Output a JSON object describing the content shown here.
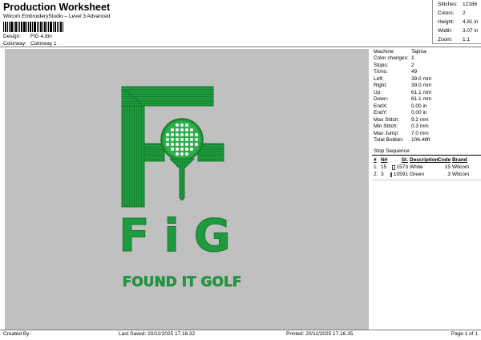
{
  "header": {
    "title": "Production Worksheet",
    "subtitle": "Wilcom EmbroideryStudio – Level 3 Advanced",
    "design_label": "Design:",
    "design_value": "FIG 4.8in",
    "colorway_label": "Colorway:",
    "colorway_value": "Colorway 1"
  },
  "stats": {
    "stitches_label": "Stitches:",
    "stitches": "12166",
    "colors_label": "Colors:",
    "colors": "2",
    "height_label": "Height:",
    "height": "4.81 in",
    "width_label": "Width:",
    "width": "3.07 in",
    "zoom_label": "Zoom:",
    "zoom": "1:1"
  },
  "specs": [
    {
      "label": "Machine:",
      "value": "Tajima"
    },
    {
      "label": "Color changes:",
      "value": "1"
    },
    {
      "label": "Stops:",
      "value": "2"
    },
    {
      "label": "Trims:",
      "value": "49"
    },
    {
      "label": "Left:",
      "value": "39.0 mm"
    },
    {
      "label": "Right:",
      "value": "39.0 mm"
    },
    {
      "label": "Up:",
      "value": "61.1 mm"
    },
    {
      "label": "Down:",
      "value": "61.1 mm"
    },
    {
      "label": "EndX:",
      "value": "0.00 in"
    },
    {
      "label": "EndY:",
      "value": "0.00 in"
    },
    {
      "label": "Max Stitch:",
      "value": "9.2 mm"
    },
    {
      "label": "Min Stitch:",
      "value": "0.3 mm"
    },
    {
      "label": "Max Jump:",
      "value": "7.0 mm"
    },
    {
      "label": "Total Bobbin:",
      "value": "106.48ft"
    }
  ],
  "sequence": {
    "title": "Stop Sequence:",
    "headers": {
      "num": "#",
      "n": "N#",
      "st": "St.",
      "desc": "Description",
      "code": "Code",
      "brand": "Brand"
    },
    "rows": [
      {
        "num": "1.",
        "n": "15",
        "st": "1573",
        "desc": "White",
        "code": "15",
        "brand": "Wilcom",
        "color": "#ffffff"
      },
      {
        "num": "2.",
        "n": "3",
        "st": "10591",
        "desc": "Green",
        "code": "3",
        "brand": "Wilcom",
        "color": "#1a9a3c"
      }
    ]
  },
  "design": {
    "text_main": "FiG",
    "text_tagline": "FOUND IT GOLF",
    "thread_green": "#1f9a3e",
    "thread_white": "#ffffff",
    "canvas_color": "#c0c0c0"
  },
  "footer": {
    "created_by": "Created By:",
    "last_saved": "Last Saved: 20/11/2025 17.16.32",
    "printed": "Printed: 20/11/2025 17.16.35",
    "page": "Page 1 of 1"
  }
}
